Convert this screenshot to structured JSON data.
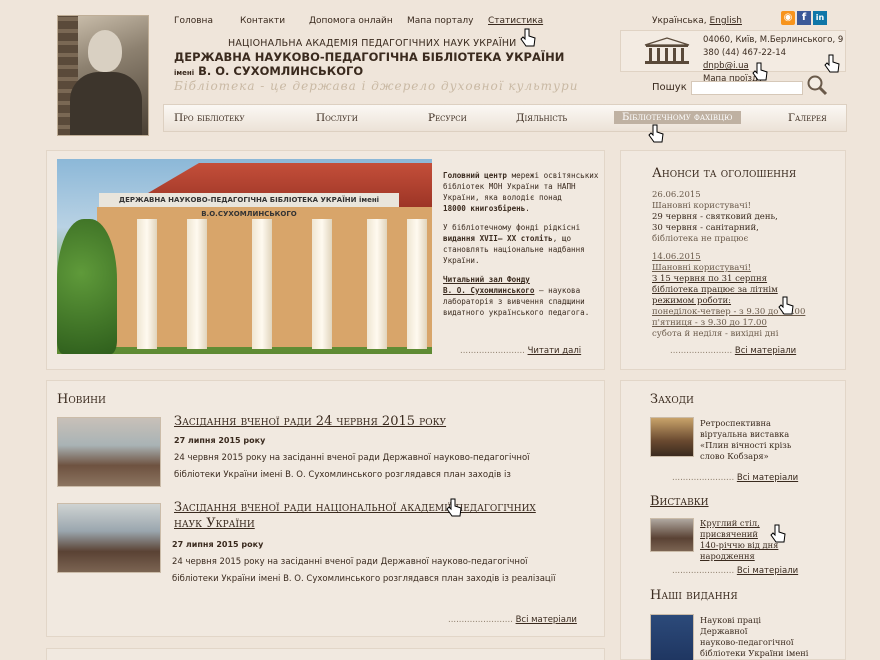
{
  "topnav": [
    "Головна",
    "Контакти",
    "Допомога онлайн",
    "Мапа порталу",
    "Статистика"
  ],
  "lang": {
    "ua": "Українська",
    "sep": ",",
    "en": "English"
  },
  "social": [
    "rss-icon",
    "facebook-icon",
    "linkedin-icon"
  ],
  "header": {
    "org1": "НАЦІОНАЛЬНА АКАДЕМІЯ ПЕДАГОГІЧНИХ НАУК УКРАЇНИ",
    "org2": "ДЕРЖАВНА НАУКОВО-ПЕДАГОГІЧНА БІБЛІОТЕКА УКРАЇНИ",
    "org3_pre": "імені",
    "org3": "В. О. СУХОМЛИНСЬКОГО",
    "slogan": "Бібліотека - це держава і джерело духовної культури"
  },
  "address": {
    "line1": "04060, Київ, М.Берлинського,  9",
    "phone": "380 (44) 467-22-14",
    "email": "dnpb@i.ua",
    "map": "Мапа проїзду"
  },
  "search": {
    "label": "Пошук",
    "value": ""
  },
  "mainnav": [
    "Про бібліотеку",
    "Послуги",
    "Ресурси",
    "Діяльність",
    "Бібліотечному фахівцю",
    "Галерея"
  ],
  "photo": {
    "sign": "ДЕРЖАВНА НАУКОВО-ПЕДАГОГІЧНА БІБЛІОТЕКА УКРАЇНИ імені В.О.СУХОМЛИНСЬКОГО"
  },
  "intro": {
    "p1_bold": "Головний центр",
    "p1": " мережі освітянських бібліотек МОН України та НАПН України, яка володіє понад",
    "p1_bold2": "18000 книгозбірень",
    "p1_end": ".",
    "p2": "У бібліотечному фонді рідкісні",
    "p2_bold": "видання XVII– XX століть",
    "p2_end": ", що становлять національне надбання України.",
    "p3_link1": "Читальний зал Фонду",
    "p3_link2": "В. О. Сухомлинського",
    "p3": " – наукова лабораторія з вивчення спадщини видатного українського педагога.",
    "readmore": "Читати далі"
  },
  "announcements": {
    "title": "Анонси та оголошення",
    "items": [
      {
        "date": "26.06.2015",
        "l1": "Шановні користувачі!",
        "l2": "29 червня - святковий день,",
        "l3": "30 червня - санітарний,",
        "l4": "бібліотека не працює"
      },
      {
        "date": "14.06.2015",
        "l1": "Шановні користувачі!",
        "l2": "З 15 червня по 31 серпня",
        "l3": "бібліотека працює за літнім",
        "l4": "режимом роботи:",
        "l5": "понеділок-четвер - з 9.30 до 18.00",
        "l6": "п'ятниця - з 9.30 до 17.00",
        "l7": "субота й неділя - вихідні дні"
      }
    ],
    "all": "Всі матеріали"
  },
  "news": {
    "title": "Новини",
    "items": [
      {
        "title": "Засідання вченої ради 24 червня 2015 року",
        "date": "27 липня 2015 року",
        "text1": "24 червня 2015 року на засіданні вченої ради Державної науково-педагогічної",
        "text2": "бібліотеки України імені В. О. Сухомлинського розглядався план заходів із"
      },
      {
        "title": "Засідання вченої ради національної академії педагогічних",
        "title2": "наук України",
        "date": "27 липня 2015 року",
        "text1": "24 червня 2015 року на засіданні вченої ради Державної науково-педагогічної",
        "text2": "бібліотеки  України імені В. О. Сухомлинського розглядався план заходів із реалізації"
      }
    ],
    "all": "Всі матеріали"
  },
  "events": {
    "title": "Заходи",
    "l1": "Ретроспективна",
    "l2": "віртуальна виставка",
    "l3": "«Плин вічності крізь",
    "l4": "слово Кобзаря»",
    "all": "Всі матеріали"
  },
  "exhibitions": {
    "title": "Виставки",
    "l1": "Круглий стіл,",
    "l2": "присвячений",
    "l3": "140-річчю від дня",
    "l4": "народження",
    "all": "Всі матеріали"
  },
  "publications": {
    "title": "Наші видання",
    "l1": "Наукові праці",
    "l2": "Державної",
    "l3": "науково-педагогічної",
    "l4": "бібліотеки України імені"
  }
}
